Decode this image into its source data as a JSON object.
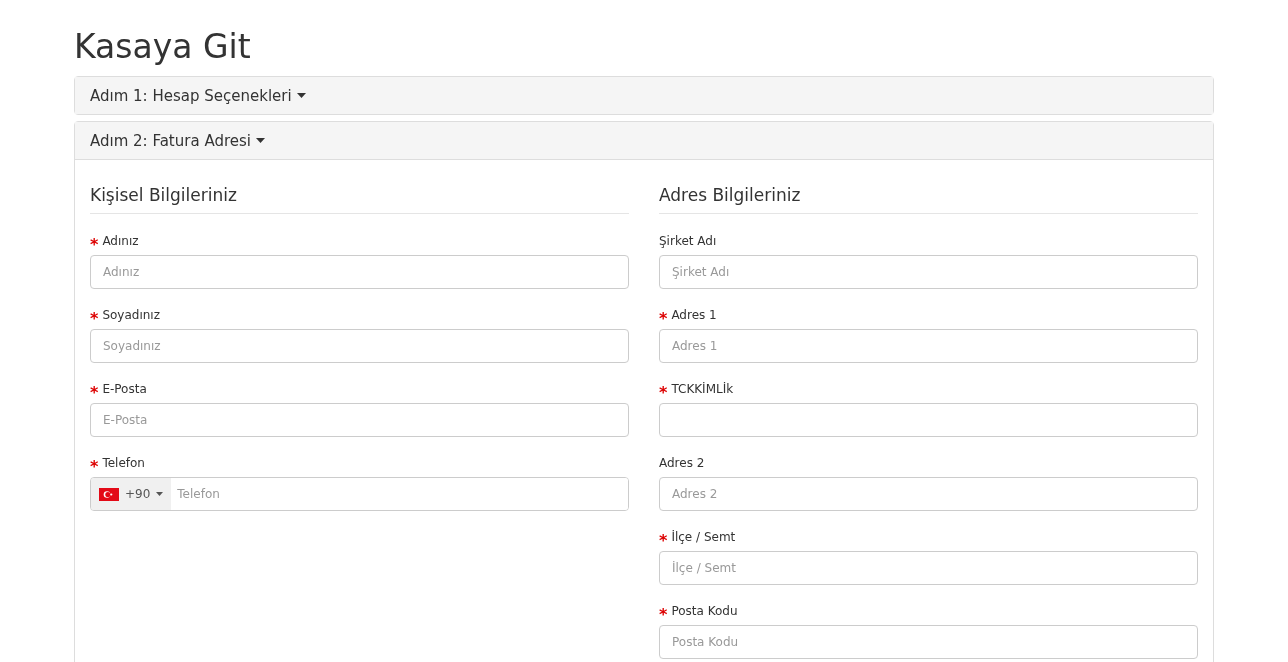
{
  "page_title": "Kasaya Git",
  "steps": [
    {
      "title": "Adım 1: Hesap Seçenekleri",
      "expanded": false
    },
    {
      "title": "Adım 2: Fatura Adresi",
      "expanded": true,
      "sections": [
        {
          "heading": "Kişisel Bilgileriniz",
          "fields": [
            {
              "kind": "text",
              "mark": "*",
              "label": "Adınız",
              "placeholder": "Adınız"
            },
            {
              "kind": "text",
              "mark": "*",
              "label": "Soyadınız",
              "placeholder": "Soyadınız"
            },
            {
              "kind": "text",
              "mark": "*",
              "label": "E-Posta",
              "placeholder": "E-Posta"
            },
            {
              "kind": "phone",
              "mark": "*",
              "label": "Telefon",
              "dial_code": "+90",
              "placeholder": "Telefon"
            }
          ]
        },
        {
          "heading": "Adres Bilgileriniz",
          "fields": [
            {
              "kind": "text",
              "label": "Şirket Adı",
              "placeholder": "Şirket Adı"
            },
            {
              "kind": "text",
              "mark": "*",
              "label": "Adres 1",
              "placeholder": "Adres 1"
            },
            {
              "kind": "text",
              "mark": "*",
              "label": "TCKKİMLİk"
            },
            {
              "kind": "text",
              "label": "Adres 2",
              "placeholder": "Adres 2"
            },
            {
              "kind": "text",
              "mark": "*",
              "label": "İlçe / Semt",
              "placeholder": "İlçe / Semt"
            },
            {
              "kind": "text",
              "mark": "*",
              "label": "Posta Kodu",
              "placeholder": "Posta Kodu"
            }
          ]
        }
      ]
    }
  ]
}
